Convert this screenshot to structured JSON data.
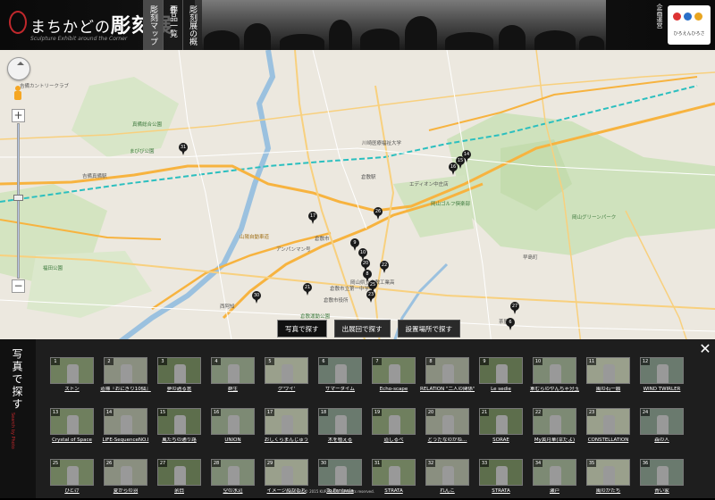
{
  "header": {
    "logo_prefix": "まちかどの",
    "logo_main": "彫刻展",
    "logo_sub": "Sculpture Exhibit around the Corner",
    "nav": [
      "彫刻マップ",
      "作品一覧",
      "彫刻展の概要"
    ],
    "organizer_label": "企画運営",
    "badge_text": "ひろえんひろさ"
  },
  "map": {
    "labels": [
      {
        "text": "吉備カントリークラブ",
        "cls": ""
      },
      {
        "text": "真備総合公園",
        "cls": "green"
      },
      {
        "text": "まびび公園",
        "cls": "green"
      },
      {
        "text": "吉備真備駅",
        "cls": ""
      },
      {
        "text": "山陽自動車道",
        "cls": "road"
      },
      {
        "text": "倉敷市",
        "cls": ""
      },
      {
        "text": "倉敷駅",
        "cls": ""
      },
      {
        "text": "岡山ゴルフ倶楽部",
        "cls": "green"
      },
      {
        "text": "エディオン中庄店",
        "cls": ""
      },
      {
        "text": "岡山グリーンパーク",
        "cls": "green"
      },
      {
        "text": "倉敷運動公園",
        "cls": "green"
      },
      {
        "text": "倉敷市立第一中学校",
        "cls": ""
      },
      {
        "text": "アンパンマン号",
        "cls": ""
      },
      {
        "text": "福田公園",
        "cls": "green"
      },
      {
        "text": "茶屋町",
        "cls": ""
      },
      {
        "text": "倉敷市役所",
        "cls": ""
      },
      {
        "text": "岡山県立倉敷工業高",
        "cls": ""
      },
      {
        "text": "西阿知",
        "cls": ""
      },
      {
        "text": "早島町",
        "cls": ""
      },
      {
        "text": "川崎医療福祉大学",
        "cls": ""
      }
    ],
    "pins": [
      "31",
      "17",
      "14",
      "15",
      "16",
      "26",
      "9",
      "10",
      "20",
      "8",
      "22",
      "30",
      "21",
      "25",
      "23",
      "27",
      "6"
    ]
  },
  "tabs": [
    "写真で探す",
    "出展回で探す",
    "設置場所で探す"
  ],
  "panel": {
    "title": "写真で探す",
    "subtitle": "Search by Photo",
    "close": "✕",
    "tiles": [
      {
        "num": "1",
        "name": "ストン"
      },
      {
        "num": "2",
        "name": "道標『おにぎり10個』"
      },
      {
        "num": "3",
        "name": "夢の過る意"
      },
      {
        "num": "4",
        "name": "群生"
      },
      {
        "num": "5",
        "name": "ク'ウイ'"
      },
      {
        "num": "6",
        "name": "サマータイム"
      },
      {
        "num": "7",
        "name": "Echo-scape"
      },
      {
        "num": "8",
        "name": "RELATION \"二人の関係\""
      },
      {
        "num": "9",
        "name": "Le sedie"
      },
      {
        "num": "10",
        "name": "軍むらのやんちゃ分玉"
      },
      {
        "num": "11",
        "name": "風の石一願"
      },
      {
        "num": "12",
        "name": "WIND TWIRLER"
      },
      {
        "num": "13",
        "name": "Crystal of Space"
      },
      {
        "num": "14",
        "name": "LIFE-SequenceNO.I"
      },
      {
        "num": "15",
        "name": "風たちの通り路"
      },
      {
        "num": "16",
        "name": "UNION"
      },
      {
        "num": "17",
        "name": "おしくらまんじゅう"
      },
      {
        "num": "18",
        "name": "木を植える"
      },
      {
        "num": "19",
        "name": "道しるべ"
      },
      {
        "num": "20",
        "name": "どうだなのかね…"
      },
      {
        "num": "21",
        "name": "SORAE"
      },
      {
        "num": "22",
        "name": "My黄月華(幸だよ)"
      },
      {
        "num": "23",
        "name": "CONSTELLATION"
      },
      {
        "num": "24",
        "name": "森の人"
      },
      {
        "num": "25",
        "name": "ひとけ"
      },
      {
        "num": "26",
        "name": "夏からの羽"
      },
      {
        "num": "27",
        "name": "余白"
      },
      {
        "num": "28",
        "name": "空の水辺"
      },
      {
        "num": "29",
        "name": "イメージのかたち"
      },
      {
        "num": "30",
        "name": "To Fantasia"
      },
      {
        "num": "31",
        "name": "STRATA"
      },
      {
        "num": "32",
        "name": "れんこ"
      },
      {
        "num": "33",
        "name": "STRATA"
      },
      {
        "num": "34",
        "name": "瀬戸"
      },
      {
        "num": "35",
        "name": "風のかたち"
      },
      {
        "num": "36",
        "name": "青い家"
      }
    ],
    "copyright": "Copyright © 2015 KURASHIKI, all rights reserved."
  }
}
